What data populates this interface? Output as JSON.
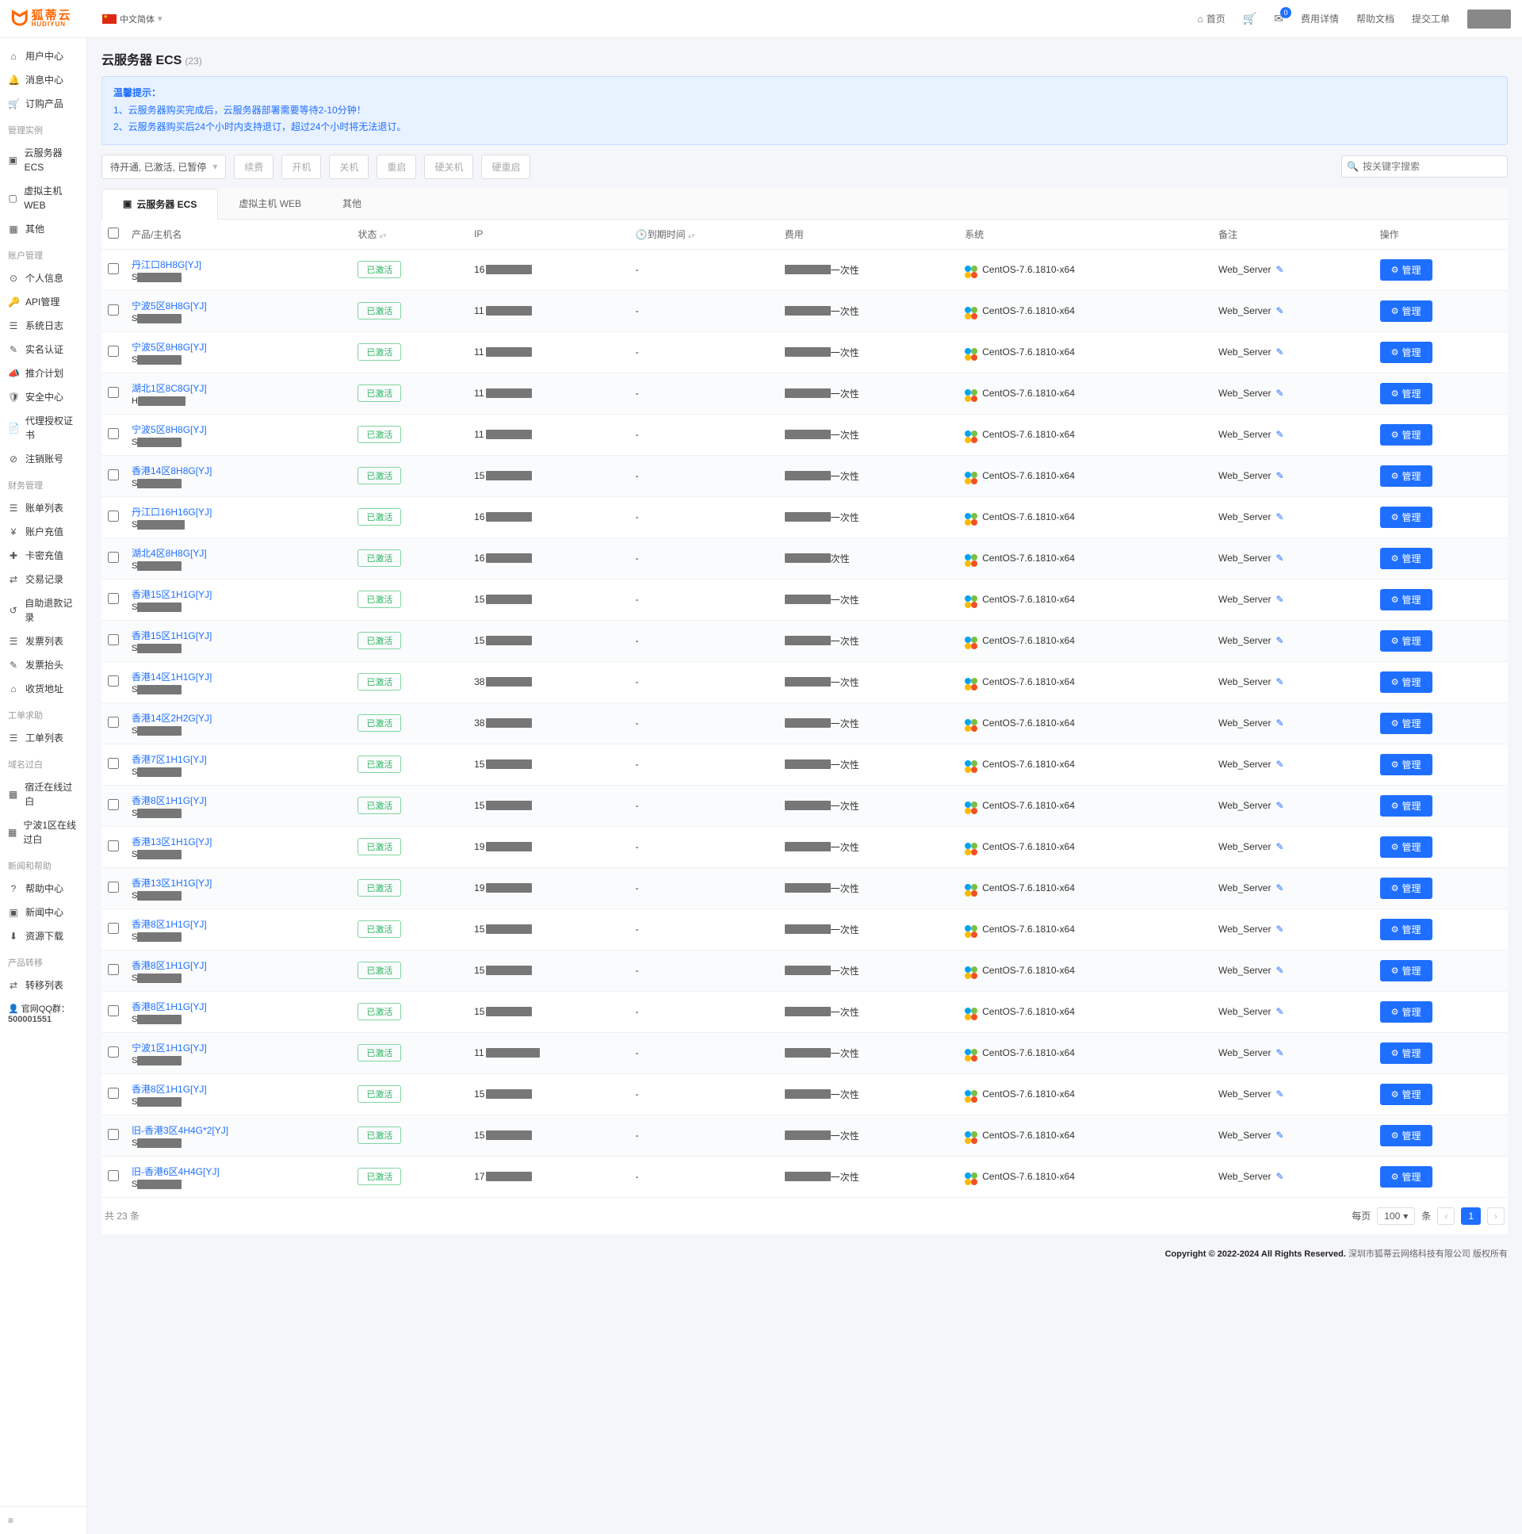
{
  "brand": {
    "cn": "狐蒂云",
    "en": "HUDIYUN"
  },
  "lang_label": "中文简体",
  "topnav": {
    "home": "首页",
    "env_badge": "0",
    "fee_detail": "费用详情",
    "help_doc": "帮助文档",
    "submit_ticket": "提交工单"
  },
  "sidebar": {
    "groups": [
      {
        "title": "",
        "items": [
          {
            "icon": "⌂",
            "label": "用户中心"
          },
          {
            "icon": "🔔",
            "label": "消息中心"
          },
          {
            "icon": "🛒",
            "label": "订购产品"
          }
        ]
      },
      {
        "title": "管理实例",
        "items": [
          {
            "icon": "▣",
            "label": "云服务器 ECS"
          },
          {
            "icon": "▢",
            "label": "虚拟主机 WEB"
          },
          {
            "icon": "▦",
            "label": "其他"
          }
        ]
      },
      {
        "title": "账户管理",
        "items": [
          {
            "icon": "⊙",
            "label": "个人信息"
          },
          {
            "icon": "🔑",
            "label": "API管理"
          },
          {
            "icon": "☰",
            "label": "系统日志"
          },
          {
            "icon": "✎",
            "label": "实名认证"
          },
          {
            "icon": "📣",
            "label": "推介计划"
          },
          {
            "icon": "🛡",
            "label": "安全中心"
          },
          {
            "icon": "📄",
            "label": "代理授权证书"
          },
          {
            "icon": "⊘",
            "label": "注销账号"
          }
        ]
      },
      {
        "title": "财务管理",
        "items": [
          {
            "icon": "☰",
            "label": "账单列表"
          },
          {
            "icon": "¥",
            "label": "账户充值"
          },
          {
            "icon": "✚",
            "label": "卡密充值"
          },
          {
            "icon": "⇄",
            "label": "交易记录"
          },
          {
            "icon": "↺",
            "label": "自助退款记录"
          },
          {
            "icon": "☰",
            "label": "发票列表"
          },
          {
            "icon": "✎",
            "label": "发票抬头"
          },
          {
            "icon": "⌂",
            "label": "收货地址"
          }
        ]
      },
      {
        "title": "工单求助",
        "items": [
          {
            "icon": "☰",
            "label": "工单列表"
          }
        ]
      },
      {
        "title": "域名过白",
        "items": [
          {
            "icon": "▦",
            "label": "宿迁在线过白"
          },
          {
            "icon": "▦",
            "label": "宁波1区在线过白"
          }
        ]
      },
      {
        "title": "新闻和帮助",
        "items": [
          {
            "icon": "?",
            "label": "帮助中心"
          },
          {
            "icon": "▣",
            "label": "新闻中心"
          },
          {
            "icon": "⬇",
            "label": "资源下载"
          }
        ]
      },
      {
        "title": "产品转移",
        "items": [
          {
            "icon": "⇄",
            "label": "转移列表"
          }
        ]
      }
    ],
    "qq_label": "官网QQ群：",
    "qq_number": "500001551"
  },
  "page": {
    "title": "云服务器 ECS",
    "count": "(23)"
  },
  "alert": {
    "title": "温馨提示：",
    "line1": "1、云服务器购买完成后，云服务器部署需要等待2-10分钟！",
    "line2": "2、云服务器购买后24个小时内支持退订，超过24个小时将无法退订。"
  },
  "toolbar": {
    "filter": "待开通, 已激活, 已暂停",
    "btns": [
      "续费",
      "开机",
      "关机",
      "重启",
      "硬关机",
      "硬重启"
    ],
    "search_placeholder": "按关键字搜索"
  },
  "tabs": [
    {
      "label": "云服务器 ECS",
      "active": true,
      "icon": "▣"
    },
    {
      "label": "虚拟主机 WEB",
      "active": false
    },
    {
      "label": "其他",
      "active": false
    }
  ],
  "columns": {
    "product": "产品/主机名",
    "status": "状态",
    "ip": "IP",
    "expire": "到期时间",
    "fee": "费用",
    "system": "系统",
    "remark": "备注",
    "op": "操作"
  },
  "common": {
    "status_active": "已激活",
    "fee_once": "一次性",
    "fee_cycle": "次性",
    "system": "CentOS-7.6.1810-x64",
    "remark": "Web_Server",
    "manage": "管理",
    "expire_empty": "-"
  },
  "rows": [
    {
      "name": "丹江口8H8G[YJ]",
      "sub_pref": "S",
      "sub_w": 56,
      "ip_pref": "16",
      "ip_w": 58
    },
    {
      "name": "宁波5区8H8G[YJ]",
      "sub_pref": "S",
      "sub_w": 56,
      "ip_pref": "11",
      "ip_w": 58
    },
    {
      "name": "宁波5区8H8G[YJ]",
      "sub_pref": "S",
      "sub_w": 56,
      "ip_pref": "11",
      "ip_w": 58
    },
    {
      "name": "湖北1区8C8G[YJ]",
      "sub_pref": "H",
      "sub_w": 60,
      "ip_pref": "11",
      "ip_w": 58
    },
    {
      "name": "宁波5区8H8G[YJ]",
      "sub_pref": "S",
      "sub_w": 56,
      "ip_pref": "11",
      "ip_w": 58
    },
    {
      "name": "香港14区8H8G[YJ]",
      "sub_pref": "S",
      "sub_w": 56,
      "ip_pref": "15",
      "ip_w": 58
    },
    {
      "name": "丹江口16H16G[YJ]",
      "sub_pref": "S",
      "sub_w": 60,
      "ip_pref": "16",
      "ip_w": 58
    },
    {
      "name": "湖北4区8H8G[YJ]",
      "sub_pref": "S",
      "sub_w": 56,
      "ip_pref": "16",
      "ip_w": 58,
      "fee_alt": true
    },
    {
      "name": "香港15区1H1G[YJ]",
      "sub_pref": "S",
      "sub_w": 56,
      "ip_pref": "15",
      "ip_w": 58
    },
    {
      "name": "香港15区1H1G[YJ]",
      "sub_pref": "S",
      "sub_w": 56,
      "ip_pref": "15",
      "ip_w": 58
    },
    {
      "name": "香港14区1H1G[YJ]",
      "sub_pref": "S",
      "sub_w": 56,
      "ip_pref": "38",
      "ip_w": 58
    },
    {
      "name": "香港14区2H2G[YJ]",
      "sub_pref": "S",
      "sub_w": 56,
      "ip_pref": "38",
      "ip_w": 58
    },
    {
      "name": "香港7区1H1G[YJ]",
      "sub_pref": "S",
      "sub_w": 56,
      "ip_pref": "15",
      "ip_w": 58
    },
    {
      "name": "香港8区1H1G[YJ]",
      "sub_pref": "S",
      "sub_w": 56,
      "ip_pref": "15",
      "ip_w": 58
    },
    {
      "name": "香港13区1H1G[YJ]",
      "sub_pref": "S",
      "sub_w": 56,
      "ip_pref": "19",
      "ip_w": 58
    },
    {
      "name": "香港13区1H1G[YJ]",
      "sub_pref": "S",
      "sub_w": 56,
      "ip_pref": "19",
      "ip_w": 58
    },
    {
      "name": "香港8区1H1G[YJ]",
      "sub_pref": "S",
      "sub_w": 56,
      "ip_pref": "15",
      "ip_w": 58
    },
    {
      "name": "香港8区1H1G[YJ]",
      "sub_pref": "S",
      "sub_w": 56,
      "ip_pref": "15",
      "ip_w": 58
    },
    {
      "name": "香港8区1H1G[YJ]",
      "sub_pref": "S",
      "sub_w": 56,
      "ip_pref": "15",
      "ip_w": 58
    },
    {
      "name": "宁波1区1H1G[YJ]",
      "sub_pref": "S",
      "sub_w": 56,
      "ip_pref": "11",
      "ip_w": 68
    },
    {
      "name": "香港8区1H1G[YJ]",
      "sub_pref": "S",
      "sub_w": 56,
      "ip_pref": "15",
      "ip_w": 58
    },
    {
      "name": "旧-香港3区4H4G*2[YJ]",
      "sub_pref": "S",
      "sub_w": 56,
      "ip_pref": "15",
      "ip_w": 58
    },
    {
      "name": "旧-香港6区4H4G[YJ]",
      "sub_pref": "S",
      "sub_w": 56,
      "ip_pref": "17",
      "ip_w": 58
    }
  ],
  "footer_total": "共 23 条",
  "pager": {
    "per_page_label": "每页",
    "per_page_val": "100",
    "unit": "条",
    "current": "1"
  },
  "copyright": "Copyright © 2022-2024 All Rights Reserved.",
  "company": "深圳市狐蒂云网络科技有限公司 版权所有"
}
